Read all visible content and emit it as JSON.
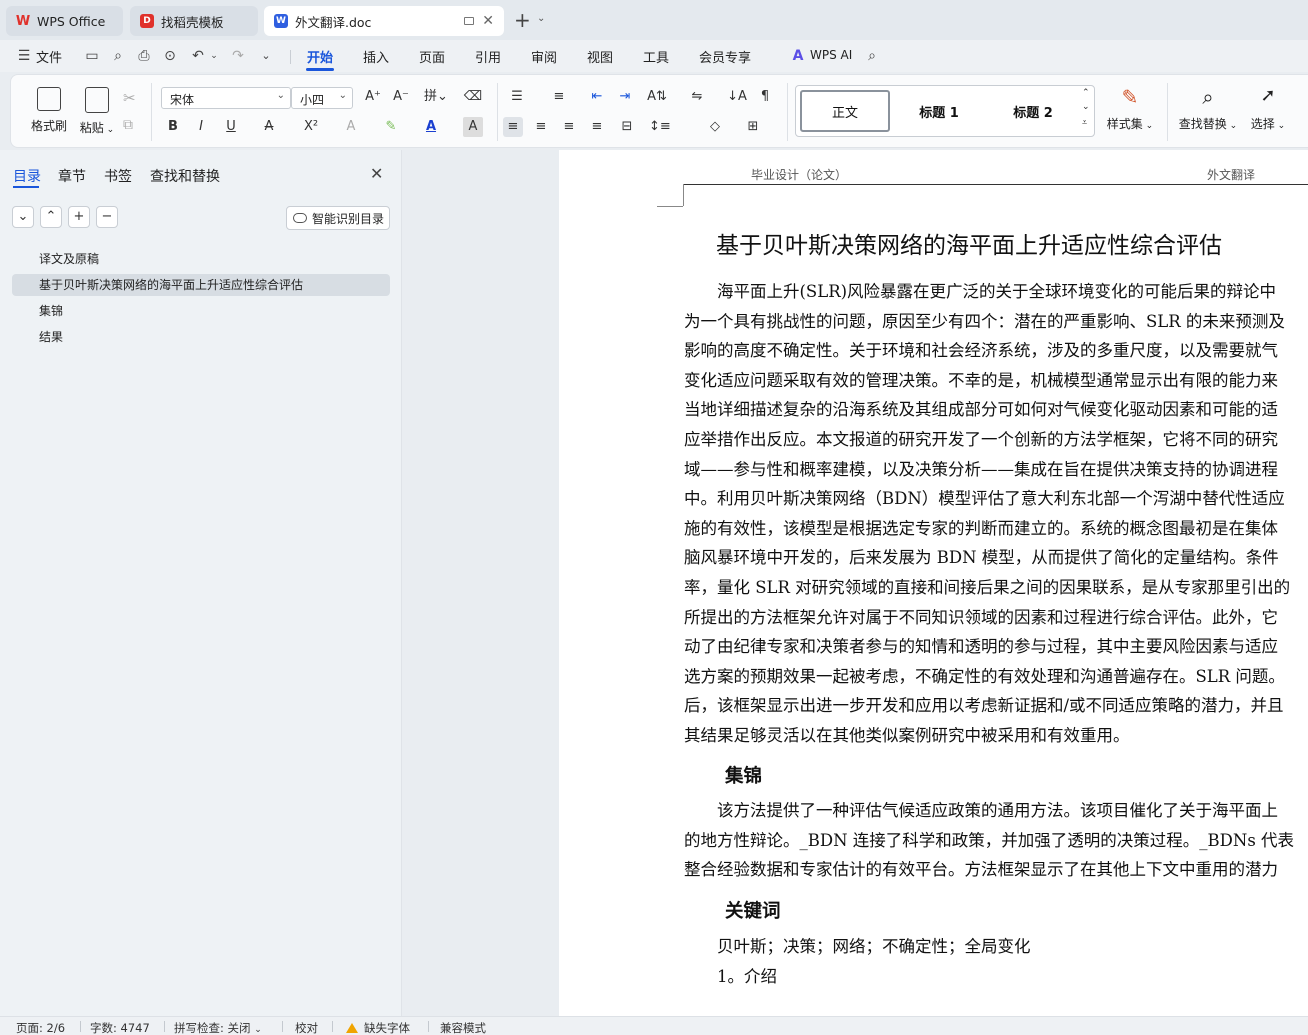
{
  "titlebar": {
    "tabs": [
      {
        "label": "WPS Office",
        "icon": "wps-logo-icon",
        "state": "inactive"
      },
      {
        "label": "找稻壳模板",
        "icon": "docer-logo-icon",
        "state": "inactive"
      },
      {
        "label": "外文翻译.doc",
        "icon": "word-doc-icon",
        "state": "active"
      }
    ],
    "new_tab": "+",
    "new_tab_menu": "⌄"
  },
  "menubar": {
    "file_label": "文件",
    "tabs": [
      "开始",
      "插入",
      "页面",
      "引用",
      "审阅",
      "视图",
      "工具",
      "会员专享"
    ],
    "active_tab": "开始",
    "wps_ai_label": "WPS AI",
    "accent_color": "#1a56db"
  },
  "ribbon": {
    "format_painter_label": "格式刷",
    "paste_label": "粘贴",
    "font_name": "宋体",
    "font_size": "小四",
    "styles": [
      "正文",
      "标题 1",
      "标题 2"
    ],
    "style_set_label": "样式集",
    "find_replace_label": "查找替换",
    "select_label": "选择"
  },
  "nav": {
    "tabs": [
      "目录",
      "章节",
      "书签",
      "查找和替换"
    ],
    "active_tab": "目录",
    "smart_toc_label": "智能识别目录",
    "toc": [
      {
        "label": "译文及原稿",
        "selected": false
      },
      {
        "label": "基于贝叶斯决策网络的海平面上升适应性综合评估",
        "selected": true
      },
      {
        "label": "集锦",
        "selected": false
      },
      {
        "label": "结果",
        "selected": false
      }
    ]
  },
  "document": {
    "header_left": "毕业设计（论文）",
    "header_right": "外文翻译",
    "title": "基于贝叶斯决策网络的海平面上升适应性综合评估",
    "abstract_lines": [
      "　　海平面上升(SLR)风险暴露在更广泛的关于全球环境变化的可能后果的辩论中",
      "为一个具有挑战性的问题，原因至少有四个：潜在的严重影响、SLR 的未来预测及",
      "影响的高度不确定性。关于环境和社会经济系统，涉及的多重尺度，以及需要就气",
      "变化适应问题采取有效的管理决策。不幸的是，机械模型通常显示出有限的能力来",
      "当地详细描述复杂的沿海系统及其组成部分可如何对气候变化驱动因素和可能的适",
      "应举措作出反应。本文报道的研究开发了一个创新的方法学框架，它将不同的研究",
      "域——参与性和概率建模，以及决策分析——集成在旨在提供决策支持的协调进程",
      "中。利用贝叶斯决策网络（BDN）模型评估了意大利东北部一个泻湖中替代性适应",
      "施的有效性，该模型是根据选定专家的判断而建立的。系统的概念图最初是在集体",
      "脑风暴环境中开发的，后来发展为 BDN 模型，从而提供了简化的定量结构。条件",
      "率，量化 SLR 对研究领域的直接和间接后果之间的因果联系，是从专家那里引出的",
      "所提出的方法框架允许对属于不同知识领域的因素和过程进行综合评估。此外，它",
      "动了由纪律专家和决策者参与的知情和透明的参与过程，其中主要风险因素与适应",
      "选方案的预期效果一起被考虑，不确定性的有效处理和沟通普遍存在。SLR 问题。",
      "后，该框架显示出进一步开发和应用以考虑新证据和/或不同适应策略的潜力，并且",
      "其结果足够灵活以在其他类似案例研究中被采用和有效重用。"
    ],
    "section_highlights": "集锦",
    "highlights_lines": [
      "　　该方法提供了一种评估气候适应政策的通用方法。该项目催化了关于海平面上",
      "的地方性辩论。_BDN 连接了科学和政策，并加强了透明的决策过程。_BDNs 代表",
      "整合经验数据和专家估计的有效平台。方法框架显示了在其他上下文中重用的潜力"
    ],
    "section_keywords": "关键词",
    "keywords_line": "　　贝叶斯；决策；网络；不确定性；全局变化",
    "intro_line": "　　1。介绍"
  },
  "statusbar": {
    "page": "页面: 2/6",
    "word_count": "字数: 4747",
    "spell_check": "拼写检查: 关闭",
    "proofread": "校对",
    "missing_fonts": "缺失字体",
    "compat_mode": "兼容模式"
  }
}
